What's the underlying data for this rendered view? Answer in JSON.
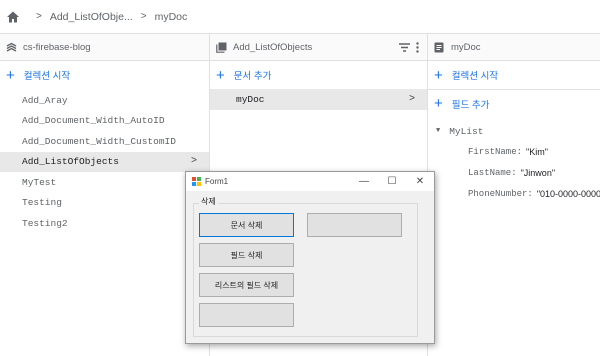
{
  "breadcrumb": {
    "items": [
      "Add_ListOfObje...",
      "myDoc"
    ]
  },
  "columns": {
    "root": {
      "title": "cs-firebase-blog",
      "add_label": "컬렉션 시작",
      "items": [
        {
          "label": "Add_Aray",
          "selected": false
        },
        {
          "label": "Add_Document_Width_AutoID",
          "selected": false
        },
        {
          "label": "Add_Document_Width_CustomID",
          "selected": false
        },
        {
          "label": "Add_ListOfObjects",
          "selected": true
        },
        {
          "label": "MyTest",
          "selected": false
        },
        {
          "label": "Testing",
          "selected": false
        },
        {
          "label": "Testing2",
          "selected": false
        }
      ]
    },
    "collection": {
      "title": "Add_ListOfObjects",
      "add_label": "문서 추가",
      "items": [
        {
          "label": "myDoc",
          "selected": true
        }
      ]
    },
    "document": {
      "title": "myDoc",
      "add_collection_label": "컬렉션 시작",
      "add_field_label": "필드 추가",
      "field_name": "MyList",
      "subfields": [
        {
          "key": "FirstName:",
          "value": "\"Kim\""
        },
        {
          "key": "LastName:",
          "value": "\"Jinwon\""
        },
        {
          "key": "PhoneNumber:",
          "value": "\"010-0000-0000\""
        }
      ]
    }
  },
  "form": {
    "title": "Form1",
    "window_buttons": {
      "minimize": "—",
      "maximize": "☐",
      "close": "✕"
    },
    "group_label": "삭제",
    "buttons": {
      "delete_document": "문서 삭제",
      "delete_field": "필드 삭제",
      "delete_list_field": "리스트의 필드 삭제",
      "blank_left": "",
      "blank_right": ""
    }
  },
  "colors": {
    "accent": "#1a73e8",
    "selected_row": "#e8e8e8",
    "winforms_focus": "#0078d7"
  },
  "icons": {
    "home": "home-icon",
    "root_header": "firebase-project-icon",
    "collection_header": "collection-icon",
    "document_header": "document-icon",
    "filter": "filter-icon",
    "more": "more-vert-icon"
  }
}
